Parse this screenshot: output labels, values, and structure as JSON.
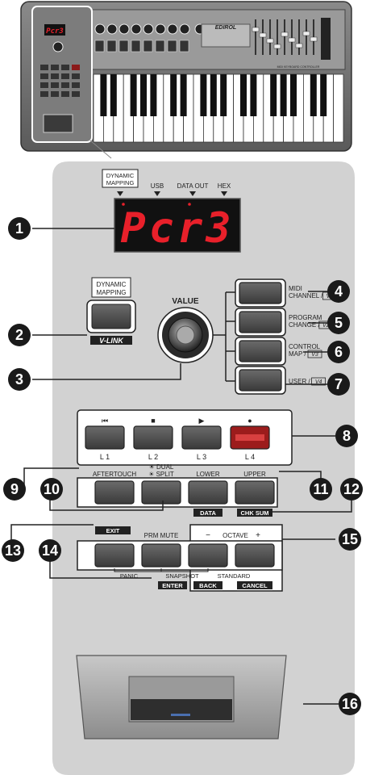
{
  "keyboard": {
    "brand": "EDIROL",
    "model": "MIDI KEYBOARD CONTROLLER"
  },
  "display": {
    "indicators": [
      "DYNAMIC\nMAPPING",
      "USB",
      "DATA OUT",
      "HEX"
    ],
    "value": "Pcr3"
  },
  "dynamic_mapping": {
    "label": "DYNAMIC\nMAPPING",
    "sublabel": "V-LINK"
  },
  "value_knob": {
    "label": "VALUE"
  },
  "right_buttons": [
    {
      "label": "MIDI\nCHANNEL /",
      "tag": "V1"
    },
    {
      "label": "PROGRAM\nCHANGE /",
      "tag": "V2"
    },
    {
      "label": "CONTROL\nMAP /",
      "tag": "V3"
    },
    {
      "label": "USER /",
      "tag": "V4"
    }
  ],
  "transport": {
    "symbols": [
      "⏮",
      "■",
      "▶",
      "●"
    ],
    "labels": [
      "L 1",
      "L 2",
      "L 3",
      "L 4"
    ]
  },
  "row_upper": {
    "labels": [
      "AFTERTOUCH",
      "DUAL\nSPLIT",
      "LOWER",
      "UPPER"
    ],
    "sublabels": [
      "DATA",
      "CHK SUM"
    ]
  },
  "row_lower": {
    "exit": "EXIT",
    "prm_mute": "PRM MUTE",
    "octave": "OCTAVE",
    "minus": "−",
    "plus": "+",
    "panic": "PANIC",
    "snapshot": "SNAPSHOT",
    "standard": "STANDARD",
    "enter": "ENTER",
    "back": "BACK",
    "cancel": "CANCEL"
  },
  "callouts": [
    "1",
    "2",
    "3",
    "4",
    "5",
    "6",
    "7",
    "8",
    "9",
    "10",
    "11",
    "12",
    "13",
    "14",
    "15",
    "16"
  ]
}
